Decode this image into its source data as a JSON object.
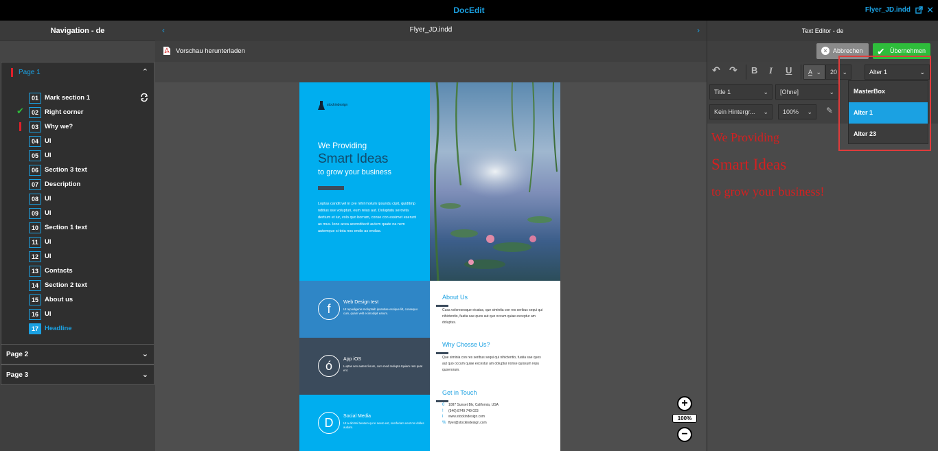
{
  "topbar": {
    "title": "DocEdit",
    "file": "Flyer_JD.indd"
  },
  "nav": {
    "title": "Navigation - de",
    "page1_label": "Page 1",
    "items": [
      {
        "num": "01",
        "label": "Mark section 1",
        "status": "none",
        "sync": true
      },
      {
        "num": "02",
        "label": "Right corner",
        "status": "check"
      },
      {
        "num": "03",
        "label": "Why we?",
        "status": "alert"
      },
      {
        "num": "04",
        "label": "UI",
        "status": "none"
      },
      {
        "num": "05",
        "label": "UI",
        "status": "none"
      },
      {
        "num": "06",
        "label": "Section 3 text",
        "status": "none"
      },
      {
        "num": "07",
        "label": "Description",
        "status": "none"
      },
      {
        "num": "08",
        "label": "UI",
        "status": "none"
      },
      {
        "num": "09",
        "label": "UI",
        "status": "none"
      },
      {
        "num": "10",
        "label": "Section 1 text",
        "status": "none"
      },
      {
        "num": "11",
        "label": "UI",
        "status": "none"
      },
      {
        "num": "12",
        "label": "UI",
        "status": "none"
      },
      {
        "num": "13",
        "label": "Contacts",
        "status": "none"
      },
      {
        "num": "14",
        "label": "Section 2 text",
        "status": "none"
      },
      {
        "num": "15",
        "label": "About us",
        "status": "none"
      },
      {
        "num": "16",
        "label": "UI",
        "status": "none"
      },
      {
        "num": "17",
        "label": "Headline",
        "status": "active"
      }
    ],
    "page2_label": "Page 2",
    "page3_label": "Page 3"
  },
  "center": {
    "title": "Flyer_JD.indd",
    "download_label": "Vorschau herunterladen",
    "zoom": "100%"
  },
  "doc": {
    "logo": "stockindesign",
    "we_providing": "We Providing",
    "smart_ideas": "Smart Ideas",
    "grow": "to grow your business",
    "lorem": "Loptas candit vel in pre nihil molum ipsundu cipit, quiditmp nditius sse volupturi, eum reius aut. Doluptatu serovita dertium et iur, volo quo borrum, conse con essimet eserunt as mus. Ione acea acernditecit autem quate na nem autemque si tota nos endis as endias.",
    "services": [
      {
        "icon": "f",
        "title": "Web Design test",
        "text": "Ut repudigenis moluptaib ipsantiae essique lilt, consequo cum, quam velit ecimodipit earum.",
        "bg": "#2f86c6"
      },
      {
        "icon": "ó",
        "title": "App iOS",
        "text": "Luptas sen autem ferum, cum mod molupta tquiam rem quat ent.",
        "bg": "#3b4b5c"
      },
      {
        "icon": "D",
        "title": "Social Media",
        "text": "Ut a dicitmi beatum qu te neeto est, scerferiam nest ms dolles audam.",
        "bg": "#00aeef"
      }
    ],
    "about_title": "About Us",
    "about_text": "Cusa voloresesque eicatus, que simintia con res seribus sequi qui nihictentio, fuatia sae quos aut quo occum quiae exceptur am doluptus.",
    "why_title": "Why Chosse Us?",
    "why_text": "Que siminia con res seribus sequi qui nihictentio, fuatia sae quos aut quo occum quiae excestur am doluptur nonse quissum repu quoerorum.",
    "touch_title": "Get in Touch",
    "contacts": [
      {
        "icon": "0",
        "text": "1087 Sunset Blv, California, USA"
      },
      {
        "icon": "!",
        "text": "(546) 8749 749 023"
      },
      {
        "icon": "i",
        "text": "www.stockindesign.com"
      },
      {
        "icon": "%",
        "text": "flyer@stockindesign.com"
      }
    ]
  },
  "editor": {
    "title": "Text Editor - de",
    "cancel_label": "Abbrechen",
    "apply_label": "Übernehmen",
    "font_size": "20",
    "alter_selected": "Alter 1",
    "style": "Title 1",
    "char_style": "[Ohne]",
    "background": "Kein Hintergr...",
    "zoom": "100%",
    "dropdown_options": [
      "MasterBox",
      "Alter 1",
      "Alter 23"
    ],
    "dropdown_selected": "Alter 1",
    "text_lines": [
      "We Providing",
      "Smart Ideas",
      "to grow your business!"
    ]
  },
  "colors": {
    "accent": "#1ba1e2",
    "apply": "#2ebd3b",
    "alert": "#e0202a",
    "editor_text": "#d42020"
  }
}
